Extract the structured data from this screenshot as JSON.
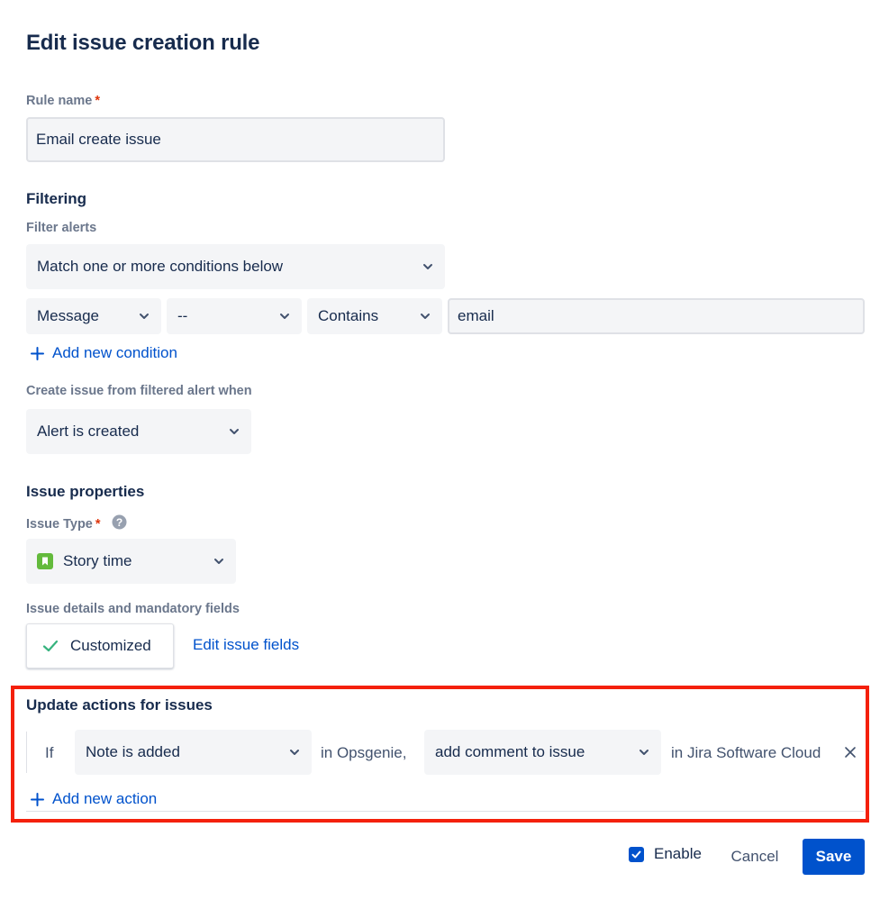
{
  "dialog": {
    "title": "Edit issue creation rule"
  },
  "rule_name": {
    "label": "Rule name",
    "required_mark": "*",
    "value": "Email create issue"
  },
  "filtering": {
    "heading": "Filtering",
    "filter_label": "Filter alerts",
    "match_select": "Match one or more conditions below",
    "condition": {
      "field": "Message",
      "not_operator": "--",
      "operator": "Contains",
      "value": "email"
    },
    "add_condition": "Add new condition",
    "create_when_label": "Create issue from filtered alert when",
    "create_when_select": "Alert is created"
  },
  "issue_properties": {
    "heading": "Issue properties",
    "type_label": "Issue Type",
    "required_mark": "*",
    "help_icon": "question-circle-icon",
    "type_icon": "story-icon",
    "type_value": "Story time",
    "details_label": "Issue details and mandatory fields",
    "customized_label": "Customized",
    "edit_fields": "Edit issue fields"
  },
  "update_actions": {
    "heading": "Update actions for issues",
    "if_label": "If",
    "trigger_select": "Note is added",
    "in_source": "in Opsgenie,",
    "action_select": "add comment to issue",
    "in_target": "in Jira Software Cloud",
    "add_action": "Add new action"
  },
  "footer": {
    "enable_label": "Enable",
    "enable_checked": true,
    "cancel": "Cancel",
    "save": "Save"
  },
  "colors": {
    "primary": "#0052cc",
    "highlight": "#f4200b",
    "required": "#de350b",
    "success": "#36b37e",
    "story": "#63ba3c"
  }
}
